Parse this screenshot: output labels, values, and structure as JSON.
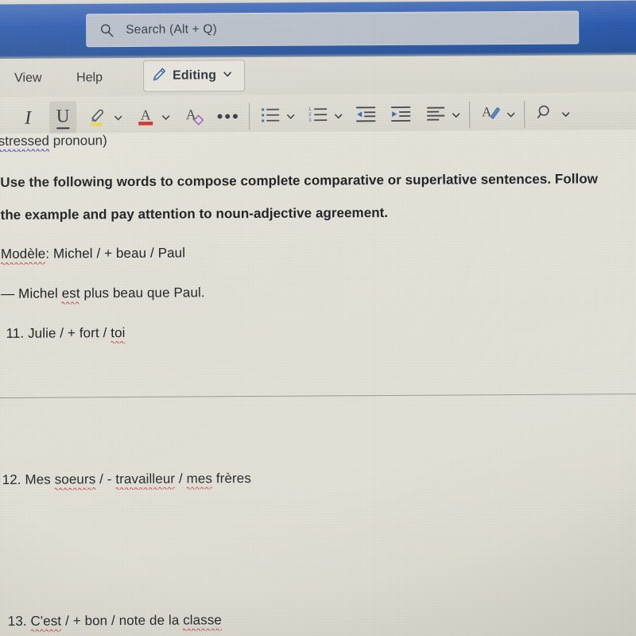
{
  "app": {
    "accent_blue": "#2b5cb7",
    "paper_color": "#e9e7dc",
    "ribbon_color": "#e3e1d7"
  },
  "search": {
    "placeholder": "Search (Alt + Q)",
    "icon": "search-icon"
  },
  "menubar": {
    "items": [
      {
        "label": "View"
      },
      {
        "label": "Help"
      }
    ],
    "editing": {
      "label": "Editing",
      "icon": "pencil-icon",
      "chevron": "chevron-down-icon"
    }
  },
  "toolbar": {
    "buttons": [
      {
        "name": "italic",
        "icon": "italic-icon",
        "label": "I",
        "active": false,
        "chevron": false
      },
      {
        "name": "underline",
        "icon": "underline-icon",
        "label": "U",
        "active": true,
        "chevron": false
      },
      {
        "name": "highlight",
        "icon": "highlighter-icon",
        "label": "",
        "active": false,
        "chevron": true,
        "color": "#f2dc4b"
      },
      {
        "name": "font-color",
        "icon": "font-color-icon",
        "label": "A",
        "active": false,
        "chevron": true,
        "color": "#d9322b"
      },
      {
        "name": "clear-formatting",
        "icon": "clear-formatting-icon",
        "label": "A",
        "active": false,
        "chevron": false,
        "color": "#a05fc0"
      },
      {
        "name": "more-options",
        "icon": "ellipsis-icon",
        "label": "…",
        "active": false,
        "chevron": false
      },
      {
        "name": "bullet-list",
        "icon": "bullet-list-icon",
        "label": "",
        "active": false,
        "chevron": true
      },
      {
        "name": "numbered-list",
        "icon": "numbered-list-icon",
        "label": "",
        "active": false,
        "chevron": true
      },
      {
        "name": "decrease-indent",
        "icon": "decrease-indent-icon",
        "label": "",
        "active": false,
        "chevron": false
      },
      {
        "name": "increase-indent",
        "icon": "increase-indent-icon",
        "label": "",
        "active": false,
        "chevron": false
      },
      {
        "name": "align",
        "icon": "align-left-icon",
        "label": "",
        "active": false,
        "chevron": true
      },
      {
        "name": "styles",
        "icon": "styles-icon",
        "label": "",
        "active": false,
        "chevron": true
      },
      {
        "name": "find",
        "icon": "find-icon",
        "label": "",
        "active": false,
        "chevron": true
      }
    ]
  },
  "document": {
    "cut_off_line": {
      "prefix": "(",
      "underlined_word": "stressed",
      "suffix": " pronoun)"
    },
    "instruction_line_1": "Use the following words to compose complete comparative or superlative sentences. Follow",
    "instruction_line_2": "the example and pay attention to noun-adjective agreement.",
    "modele": {
      "label": "Modèle",
      "rest": ": Michel / + beau / Paul"
    },
    "example_answer": {
      "dash": "— Michel ",
      "misspelled": "est",
      "rest": " plus beau que Paul."
    },
    "items": [
      {
        "number": "11.",
        "parts": [
          {
            "text": " Julie / + fort / ",
            "spell": false
          },
          {
            "text": "toi",
            "spell": true
          }
        ]
      },
      {
        "number": "12.",
        "parts": [
          {
            "text": " Mes ",
            "spell": false
          },
          {
            "text": "soeurs",
            "spell": true
          },
          {
            "text": " / - ",
            "spell": false
          },
          {
            "text": "travailleur",
            "spell": true
          },
          {
            "text": " / ",
            "spell": false
          },
          {
            "text": "mes",
            "spell": true
          },
          {
            "text": " frères",
            "spell": false
          }
        ]
      },
      {
        "number": "13.",
        "parts": [
          {
            "text": " ",
            "spell": false
          },
          {
            "text": "C'est",
            "spell": true
          },
          {
            "text": " / + bon / note de la ",
            "spell": false
          },
          {
            "text": "classe",
            "spell": true
          }
        ]
      }
    ]
  }
}
